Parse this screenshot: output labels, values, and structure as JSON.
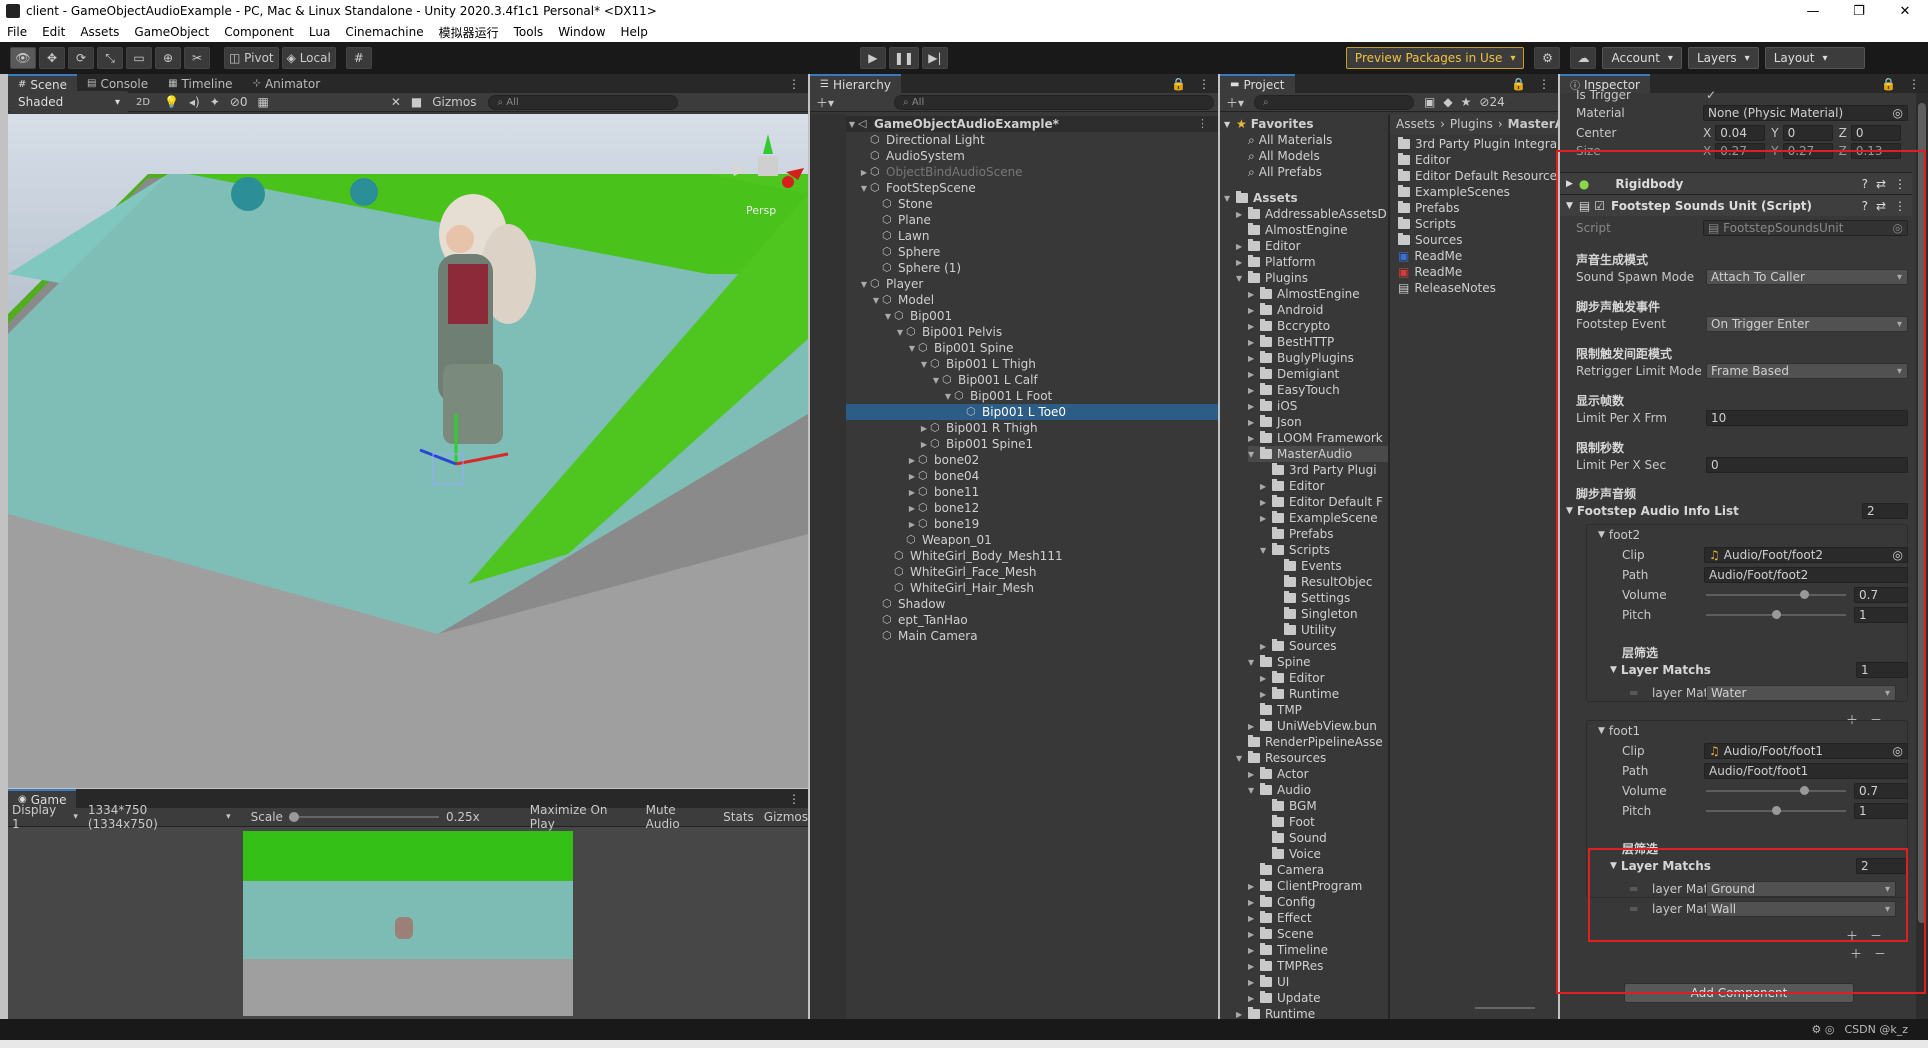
{
  "window": {
    "title": "client - GameObjectAudioExample - PC, Mac & Linux Standalone - Unity 2020.3.4f1c1 Personal* <DX11>",
    "minimize": "—",
    "maximize": "❐",
    "close": "✕"
  },
  "menu": [
    "File",
    "Edit",
    "Assets",
    "GameObject",
    "Component",
    "Lua",
    "Cinemachine",
    "模拟器运行",
    "Tools",
    "Window",
    "Help"
  ],
  "toolbar": {
    "pivot": "Pivot",
    "local": "Local",
    "preview_packages": "Preview Packages in Use",
    "account": "Account",
    "layers": "Layers",
    "layout": "Layout"
  },
  "scene": {
    "tabs": [
      "Scene",
      "Console",
      "Timeline",
      "Animator"
    ],
    "shading": "Shaded",
    "mode2d": "2D",
    "hidden_count": "0",
    "gizmos": "Gizmos",
    "search_placeholder": "All",
    "persp_label": "Persp"
  },
  "game": {
    "tab": "Game",
    "display": "Display 1",
    "resolution": "1334*750 (1334x750)",
    "scale_label": "Scale",
    "scale_value": "0.25x",
    "maximize": "Maximize On Play",
    "mute": "Mute Audio",
    "stats": "Stats",
    "gizmos": "Gizmos"
  },
  "hierarchy": {
    "tab": "Hierarchy",
    "search_placeholder": "All",
    "items": [
      {
        "label": "GameObjectAudioExample*",
        "depth": 0,
        "arrow": "▼"
      },
      {
        "label": "Directional Light",
        "depth": 1,
        "arrow": ""
      },
      {
        "label": "AudioSystem",
        "depth": 1,
        "arrow": ""
      },
      {
        "label": "ObjectBindAudioScene",
        "depth": 1,
        "arrow": "▶"
      },
      {
        "label": "FootStepScene",
        "depth": 1,
        "arrow": "▼"
      },
      {
        "label": "Stone",
        "depth": 2,
        "arrow": ""
      },
      {
        "label": "Plane",
        "depth": 2,
        "arrow": ""
      },
      {
        "label": "Lawn",
        "depth": 2,
        "arrow": ""
      },
      {
        "label": "Sphere",
        "depth": 2,
        "arrow": ""
      },
      {
        "label": "Sphere (1)",
        "depth": 2,
        "arrow": ""
      },
      {
        "label": "Player",
        "depth": 1,
        "arrow": "▼"
      },
      {
        "label": "Model",
        "depth": 2,
        "arrow": "▼"
      },
      {
        "label": "Bip001",
        "depth": 3,
        "arrow": "▼"
      },
      {
        "label": "Bip001 Pelvis",
        "depth": 4,
        "arrow": "▼"
      },
      {
        "label": "Bip001 Spine",
        "depth": 5,
        "arrow": "▼"
      },
      {
        "label": "Bip001 L Thigh",
        "depth": 6,
        "arrow": "▼"
      },
      {
        "label": "Bip001 L Calf",
        "depth": 7,
        "arrow": "▼"
      },
      {
        "label": "Bip001 L Foot",
        "depth": 8,
        "arrow": "▼"
      },
      {
        "label": "Bip001 L Toe0",
        "depth": 9,
        "arrow": ""
      },
      {
        "label": "Bip001 R Thigh",
        "depth": 6,
        "arrow": "▶"
      },
      {
        "label": "Bip001 Spine1",
        "depth": 6,
        "arrow": "▶"
      },
      {
        "label": "bone02",
        "depth": 5,
        "arrow": "▶"
      },
      {
        "label": "bone04",
        "depth": 5,
        "arrow": "▶"
      },
      {
        "label": "bone11",
        "depth": 5,
        "arrow": "▶"
      },
      {
        "label": "bone12",
        "depth": 5,
        "arrow": "▶"
      },
      {
        "label": "bone19",
        "depth": 5,
        "arrow": "▶"
      },
      {
        "label": "Weapon_01",
        "depth": 4,
        "arrow": ""
      },
      {
        "label": "WhiteGirl_Body_Mesh111",
        "depth": 3,
        "arrow": ""
      },
      {
        "label": "WhiteGirl_Face_Mesh",
        "depth": 3,
        "arrow": ""
      },
      {
        "label": "WhiteGirl_Hair_Mesh",
        "depth": 3,
        "arrow": ""
      },
      {
        "label": "Shadow",
        "depth": 2,
        "arrow": ""
      },
      {
        "label": "ept_TanHao",
        "depth": 2,
        "arrow": ""
      },
      {
        "label": "Main Camera",
        "depth": 2,
        "arrow": ""
      }
    ]
  },
  "project": {
    "tab": "Project",
    "hidden_count": "24",
    "breadcrumb": [
      "Assets",
      "Plugins",
      "MasterA"
    ],
    "favorites": {
      "label": "Favorites",
      "items": [
        "All Materials",
        "All Models",
        "All Prefabs"
      ]
    },
    "tree": [
      {
        "label": "Assets",
        "depth": 0,
        "arrow": "▼"
      },
      {
        "label": "AddressableAssetsD",
        "depth": 1,
        "arrow": "▶"
      },
      {
        "label": "AlmostEngine",
        "depth": 1,
        "arrow": ""
      },
      {
        "label": "Editor",
        "depth": 1,
        "arrow": "▶"
      },
      {
        "label": "Platform",
        "depth": 1,
        "arrow": "▶"
      },
      {
        "label": "Plugins",
        "depth": 1,
        "arrow": "▼"
      },
      {
        "label": "AlmostEngine",
        "depth": 2,
        "arrow": "▶"
      },
      {
        "label": "Android",
        "depth": 2,
        "arrow": "▶"
      },
      {
        "label": "Bccrypto",
        "depth": 2,
        "arrow": "▶"
      },
      {
        "label": "BestHTTP",
        "depth": 2,
        "arrow": "▶"
      },
      {
        "label": "BuglyPlugins",
        "depth": 2,
        "arrow": "▶"
      },
      {
        "label": "Demigiant",
        "depth": 2,
        "arrow": "▶"
      },
      {
        "label": "EasyTouch",
        "depth": 2,
        "arrow": "▶"
      },
      {
        "label": "iOS",
        "depth": 2,
        "arrow": "▶"
      },
      {
        "label": "Json",
        "depth": 2,
        "arrow": "▶"
      },
      {
        "label": "LOOM Framework",
        "depth": 2,
        "arrow": "▶"
      },
      {
        "label": "MasterAudio",
        "depth": 2,
        "arrow": "▼"
      },
      {
        "label": "3rd Party Plugi",
        "depth": 3,
        "arrow": ""
      },
      {
        "label": "Editor",
        "depth": 3,
        "arrow": "▶"
      },
      {
        "label": "Editor Default F",
        "depth": 3,
        "arrow": "▶"
      },
      {
        "label": "ExampleScene",
        "depth": 3,
        "arrow": "▶"
      },
      {
        "label": "Prefabs",
        "depth": 3,
        "arrow": ""
      },
      {
        "label": "Scripts",
        "depth": 3,
        "arrow": "▼"
      },
      {
        "label": "Events",
        "depth": 4,
        "arrow": ""
      },
      {
        "label": "ResultObjec",
        "depth": 4,
        "arrow": ""
      },
      {
        "label": "Settings",
        "depth": 4,
        "arrow": ""
      },
      {
        "label": "Singleton",
        "depth": 4,
        "arrow": ""
      },
      {
        "label": "Utility",
        "depth": 4,
        "arrow": ""
      },
      {
        "label": "Sources",
        "depth": 3,
        "arrow": "▶"
      },
      {
        "label": "Spine",
        "depth": 2,
        "arrow": "▼"
      },
      {
        "label": "Editor",
        "depth": 3,
        "arrow": "▶"
      },
      {
        "label": "Runtime",
        "depth": 3,
        "arrow": "▶"
      },
      {
        "label": "TMP",
        "depth": 2,
        "arrow": ""
      },
      {
        "label": "UniWebView.bun",
        "depth": 2,
        "arrow": "▶"
      },
      {
        "label": "RenderPipelineAsse",
        "depth": 1,
        "arrow": ""
      },
      {
        "label": "Resources",
        "depth": 1,
        "arrow": "▼"
      },
      {
        "label": "Actor",
        "depth": 2,
        "arrow": "▶"
      },
      {
        "label": "Audio",
        "depth": 2,
        "arrow": "▼"
      },
      {
        "label": "BGM",
        "depth": 3,
        "arrow": ""
      },
      {
        "label": "Foot",
        "depth": 3,
        "arrow": ""
      },
      {
        "label": "Sound",
        "depth": 3,
        "arrow": ""
      },
      {
        "label": "Voice",
        "depth": 3,
        "arrow": ""
      },
      {
        "label": "Camera",
        "depth": 2,
        "arrow": ""
      },
      {
        "label": "ClientProgram",
        "depth": 2,
        "arrow": "▶"
      },
      {
        "label": "Config",
        "depth": 2,
        "arrow": "▶"
      },
      {
        "label": "Effect",
        "depth": 2,
        "arrow": "▶"
      },
      {
        "label": "Scene",
        "depth": 2,
        "arrow": "▶"
      },
      {
        "label": "Timeline",
        "depth": 2,
        "arrow": "▶"
      },
      {
        "label": "TMPRes",
        "depth": 2,
        "arrow": "▶"
      },
      {
        "label": "UI",
        "depth": 2,
        "arrow": "▶"
      },
      {
        "label": "Update",
        "depth": 2,
        "arrow": "▶"
      },
      {
        "label": "Runtime",
        "depth": 1,
        "arrow": "▶"
      }
    ],
    "files": [
      {
        "label": "3rd Party Plugin Integra",
        "kind": "folder"
      },
      {
        "label": "Editor",
        "kind": "folder"
      },
      {
        "label": "Editor Default Resource",
        "kind": "folder"
      },
      {
        "label": "ExampleScenes",
        "kind": "folder"
      },
      {
        "label": "Prefabs",
        "kind": "folder"
      },
      {
        "label": "Scripts",
        "kind": "folder"
      },
      {
        "label": "Sources",
        "kind": "folder"
      },
      {
        "label": "ReadMe",
        "kind": "word"
      },
      {
        "label": "ReadMe",
        "kind": "pdf"
      },
      {
        "label": "ReleaseNotes",
        "kind": "text"
      }
    ]
  },
  "inspector": {
    "tab": "Inspector",
    "is_trigger_label": "Is Trigger",
    "material_label": "Material",
    "material_value": "None (Physic Material)",
    "center_label": "Center",
    "center": {
      "x": "0.04",
      "y": "0",
      "z": "0"
    },
    "size_label": "Size",
    "size": {
      "x": "0.27",
      "y": "0.27",
      "z": "0.13"
    },
    "rigidbody": "Rigidbody",
    "script_component": "Footstep Sounds Unit (Script)",
    "script_label": "Script",
    "script_value": "FootstepSoundsUnit",
    "sections": [
      {
        "cn": "声音生成模式",
        "label": "Sound Spawn Mode",
        "value": "Attach To Caller",
        "dropdown": true
      },
      {
        "cn": "脚步声触发事件",
        "label": "Footstep Event",
        "value": "On Trigger Enter",
        "dropdown": true
      },
      {
        "cn": "限制触发间距模式",
        "label": "Retrigger Limit Mode",
        "value": "Frame Based",
        "dropdown": true
      },
      {
        "cn": "显示帧数",
        "label": "Limit Per X Frm",
        "value": "10",
        "dropdown": false
      },
      {
        "cn": "限制秒数",
        "label": "Limit Per X Sec",
        "value": "0",
        "dropdown": false
      }
    ],
    "audio_list_cn": "脚步声音频",
    "audio_list_label": "Footstep Audio Info List",
    "audio_list_count": "2",
    "entries": [
      {
        "name": "foot2",
        "clip": "Audio/Foot/foot2",
        "path": "Audio/Foot/foot2",
        "volume": "0.7",
        "volume_frac": 0.7,
        "pitch": "1",
        "pitch_frac": 0.5,
        "layer_cn": "层筛选",
        "layer_label": "Layer Matchs",
        "layer_count": "1",
        "layers": [
          {
            "label": "layer Mat",
            "value": "Water"
          }
        ]
      },
      {
        "name": "foot1",
        "clip": "Audio/Foot/foot1",
        "path": "Audio/Foot/foot1",
        "volume": "0.7",
        "volume_frac": 0.7,
        "pitch": "1",
        "pitch_frac": 0.5,
        "layer_cn": "层筛选",
        "layer_label": "Layer Matchs",
        "layer_count": "2",
        "layers": [
          {
            "label": "layer Mat",
            "value": "Ground"
          },
          {
            "label": "layer Mat",
            "value": "Wall"
          }
        ]
      }
    ],
    "field_labels": {
      "clip": "Clip",
      "path": "Path",
      "volume": "Volume",
      "pitch": "Pitch"
    },
    "add_component": "Add Component"
  },
  "status": {
    "watermark": "CSDN @k_z"
  },
  "colors": {
    "accent": "#3a79bb",
    "highlight_box": "#e02020",
    "selection": "#2c5d87",
    "preview_gold": "#f0c040"
  }
}
